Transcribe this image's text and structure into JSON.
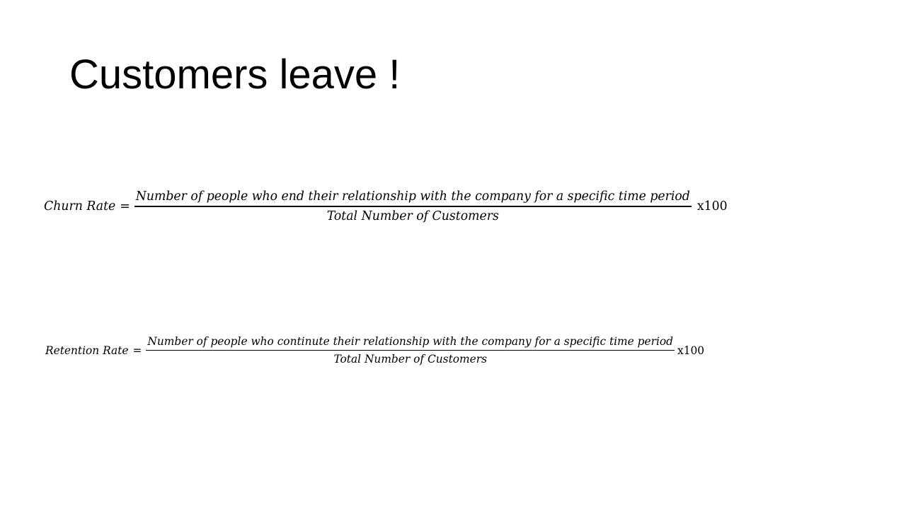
{
  "slide": {
    "title": "Customers leave !"
  },
  "formulas": {
    "churn": {
      "lhs": "Churn Rate",
      "equals": "=",
      "numerator": "Number of people who end their relationship with the company for a specific time period",
      "denominator": "Total Number of Customers",
      "multiplier": "x100"
    },
    "retention": {
      "lhs": "Retention Rate",
      "equals": "=",
      "numerator": "Number of people who continute their relationship with the company for a specific time period",
      "denominator": "Total Number of Customers",
      "multiplier": "x100"
    }
  }
}
